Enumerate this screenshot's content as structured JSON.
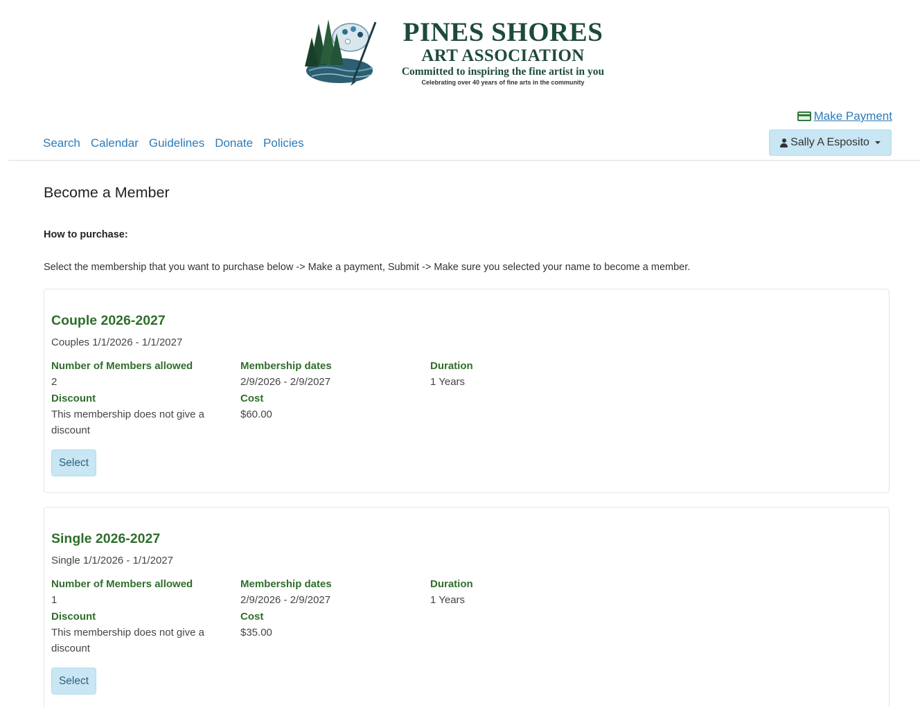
{
  "header": {
    "logo": {
      "title": "PINES SHORES",
      "subtitle": "ART ASSOCIATION",
      "tagline": "Committed to inspiring the fine artist in you",
      "small": "Celebrating over 40 years of fine arts in the community"
    },
    "make_payment": "Make Payment",
    "user_name": "Sally A Esposito"
  },
  "nav": {
    "items": [
      "Search",
      "Calendar",
      "Guidelines",
      "Donate",
      "Policies"
    ]
  },
  "page": {
    "title": "Become a Member",
    "how_label": "How to purchase:",
    "instructions": "Select the membership that you want to purchase below -> Make a payment, Submit  -> Make sure you selected your name to become a member."
  },
  "labels": {
    "members_allowed": "Number of Members allowed",
    "membership_dates": "Membership dates",
    "duration": "Duration",
    "discount": "Discount",
    "cost": "Cost",
    "select": "Select"
  },
  "memberships": [
    {
      "title": "Couple 2026-2027",
      "description": "Couples 1/1/2026 - 1/1/2027",
      "members_allowed": "2",
      "membership_dates": "2/9/2026 - 2/9/2027",
      "duration": "1 Years",
      "discount": "This membership does not give a discount",
      "cost": "$60.00"
    },
    {
      "title": "Single 2026-2027",
      "description": "Single 1/1/2026 - 1/1/2027",
      "members_allowed": "1",
      "membership_dates": "2/9/2026 - 2/9/2027",
      "duration": "1 Years",
      "discount": "This membership does not give a discount",
      "cost": "$35.00"
    }
  ],
  "colors": {
    "link": "#2a7ab8",
    "heading_green": "#2f6e2b",
    "button_bg": "#c8e6f3",
    "logo_green": "#1d4a3b"
  }
}
